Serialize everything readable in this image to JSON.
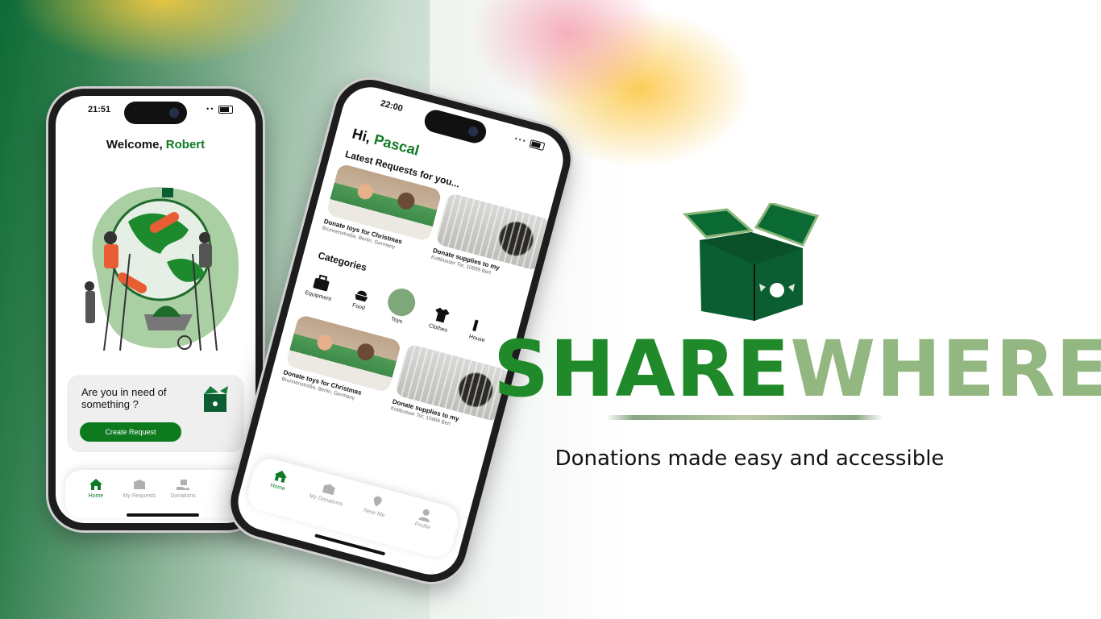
{
  "brand": {
    "name_part1": "SHARE",
    "name_part2": "WHERE",
    "tagline": "Donations made easy and accessible",
    "colors": {
      "primary": "#208a2a",
      "secondary": "#93b780",
      "box": "#0b5e31"
    }
  },
  "phone1": {
    "time": "21:51",
    "welcome_prefix": "Welcome, ",
    "user_name": "Robert",
    "card_text": "Are you in need of something ?",
    "create_button": "Create Request",
    "tabs": [
      {
        "label": "Home",
        "icon": "home-icon",
        "active": true
      },
      {
        "label": "My Requests",
        "icon": "box-icon"
      },
      {
        "label": "Donations",
        "icon": "hand-gift-icon"
      }
    ]
  },
  "phone2": {
    "time": "22:00",
    "greeting": "Hi, ",
    "user_name": "Pascal",
    "latest_title": "Latest Requests for you...",
    "categories_title": "Categories",
    "requests": [
      {
        "title": "Donate toys for Christmas",
        "address": "Brunnenstraße, Berlin, Germany",
        "image": "children-drawing"
      },
      {
        "title": "Donate supplies to my",
        "address": "Kottbusser Tor, 10999 Berl",
        "image": "dog-in-cage"
      }
    ],
    "categories": [
      {
        "label": "Equipment",
        "icon": "toolbox-icon"
      },
      {
        "label": "Food",
        "icon": "food-icon"
      },
      {
        "label": "Toys",
        "icon": "teddy-bear-icon",
        "active": true
      },
      {
        "label": "Clothes",
        "icon": "shirt-icon"
      },
      {
        "label": "House",
        "icon": "house-icon"
      }
    ],
    "requests_row2": [
      {
        "title": "Donate toys for Christmas",
        "address": "Brunnenstraße, Berlin, Germany"
      },
      {
        "title": "Donate supplies to my",
        "address": "Kottbusser Tor, 10999 Berl"
      }
    ],
    "tabs": [
      {
        "label": "Home",
        "icon": "home-icon",
        "active": true
      },
      {
        "label": "My Donations",
        "icon": "box-icon"
      },
      {
        "label": "Near Me",
        "icon": "location-pin-icon"
      },
      {
        "label": "Profile",
        "icon": "person-icon"
      }
    ]
  }
}
